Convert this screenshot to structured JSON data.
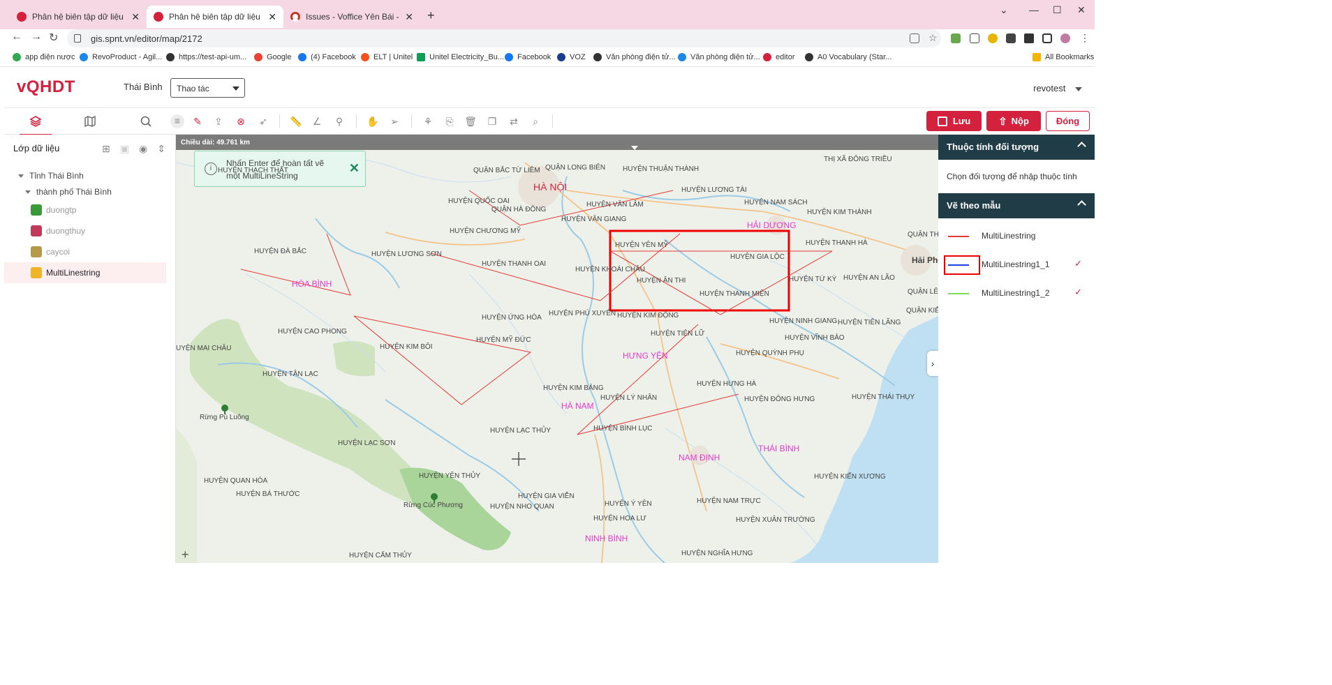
{
  "browser": {
    "tabs": [
      {
        "title": "Phân hệ biên tập dữ liệu bản đồ",
        "active": false
      },
      {
        "title": "Phân hệ biên tập dữ liệu bản đồ",
        "active": true
      },
      {
        "title": "Issues - Voffice Yên Bái - Redmine",
        "active": false
      }
    ],
    "url": "gis.spnt.vn/editor/map/2172",
    "bookmarks": [
      "app điện nược",
      "RevoProduct - Agil...",
      "https://test-api-um...",
      "Google",
      "(4) Facebook",
      "ELT | Unitel",
      "Unitel Electricity_Bu...",
      "Facebook",
      "VOZ",
      "Văn phòng điện tử...",
      "Văn phòng điện tử...",
      "editor",
      "A0 Vocabulary (Star...",
      "All Bookmarks"
    ]
  },
  "header": {
    "logo": "vQHDT",
    "province": "Thái Bình",
    "action_select": "Thao tác",
    "user": "revotest"
  },
  "left_panel": {
    "title": "Lớp dữ liệu",
    "tree": {
      "root": "Tỉnh Thái Bình",
      "child": "thành phố Thái Bình",
      "layers": [
        {
          "name": "duongtp",
          "color": "#3a9a3a"
        },
        {
          "name": "duongthuy",
          "color": "#c23a5a"
        },
        {
          "name": "caycoi",
          "color": "#b59a4a"
        },
        {
          "name": "MultiLinestring",
          "color": "#f0b429"
        }
      ]
    }
  },
  "actions": {
    "save": "Lưu",
    "submit": "Nộp",
    "close": "Đóng"
  },
  "map": {
    "measure": "Chiều dài: 49.761 km",
    "toast": "Nhấn Enter để hoàn tất vẽ một MultiLineString",
    "labels": {
      "hanoi": "HÀ NỘI",
      "hoabinh": "HÒA BÌNH",
      "haiduong": "HẢI DƯƠNG",
      "hungyen": "HƯNG YÊN",
      "hanam": "HÀ NAM",
      "namdinh": "NAM ĐỊNH",
      "thaibinh": "THÁI BÌNH",
      "ninhbinh": "NINH BÌNH",
      "haiphong": "Hải Phò",
      "thachthat": "HUYỆN THẠCH THẤT",
      "bactuliem": "QUẬN BẮC TỪ LIÊM",
      "longbien": "QUẬN LONG BIÊN",
      "thuanthanh": "HUYỆN THUẬN THÀNH",
      "dongtrieu": "THỊ XÃ ĐÔNG TRIỀU",
      "quocoai": "HUYỆN QUỐC OAI",
      "hadong": "QUẬN HÀ ĐÔNG",
      "vanlam": "HUYỆN VĂN LÂM",
      "luongtai": "HUYỆN LƯƠNG TÀI",
      "namsach": "HUYỆN NAM SÁCH",
      "kimthanh": "HUYỆN KIM THÀNH",
      "chuongmy": "HUYỆN CHƯƠNG MỸ",
      "vangiang": "HUYỆN VĂN GIANG",
      "yenmy": "HUYỆN YÊN MỸ",
      "thanhha": "HUYỆN THANH HÀ",
      "daбac": "HUYỆN ĐÀ BẮC",
      "luongson": "HUYỆN LƯƠNG SƠN",
      "thanhoai": "HUYỆN THANH OAI",
      "khoaichau": "HUYỆN KHOÁI CHÂU",
      "gialoc": "HUYỆN GIA LỘC",
      "anthi": "HUYỆN ÂN THI",
      "tuky": "HUYỆN TỨ KỲ",
      "anlao": "HUYỆN AN LÃO",
      "thanhmien": "HUYỆN THANH MIỆN",
      "unghoa": "HUYỆN ỨNG HÒA",
      "phuxuyen": "HUYỆN PHÚ XUYÊN",
      "kimdong": "HUYỆN KIM ĐỘNG",
      "ninhgiang": "HUYỆN NINH GIANG",
      "tienlang": "HUYỆN TIÊN LÃNG",
      "caophong": "HUYỆN CAO PHONG",
      "myduc": "HUYỆN MỸ ĐỨC",
      "tienlu": "HUYỆN TIÊN LỮ",
      "vinhbao": "HUYỆN VĨNH BẢO",
      "maichau": "UYỆN MAI CHÂU",
      "kimboi": "HUYỆN KIM BÔI",
      "quynhphu": "HUYỆN QUỲNH PHỤ",
      "tanlac": "HUYỆN TÂN LẠC",
      "kimbang": "HUYỆN KIM BẢNG",
      "hungha": "HUYỆN HƯNG HÀ",
      "lynhan": "HUYỆN LÝ NHÂN",
      "donghung": "HUYỆN ĐÔNG HƯNG",
      "thaithuy": "HUYỆN THÁI THỤY",
      "puluong": "Rừng Pù Luông",
      "binhluc": "HUYỆN BÌNH LỤC",
      "lacthuy": "HUYỆN LẠC THỦY",
      "lacson": "HUYỆN LẠC SƠN",
      "yenthuy": "HUYỆN YÊN THỦY",
      "kienxuong": "HUYỆN KIẾN XƯƠNG",
      "quanhoa": "HUYỆN QUAN HÓA",
      "bathuoc": "HUYỆN BÁ THƯỚC",
      "giavien": "HUYỆN GIA VIỄN",
      "namtruc": "HUYỆN NAM TRỰC",
      "cucphuong": "Rừng Cúc Phương",
      "nhoquan": "HUYỆN NHO QUAN",
      "yyen": "HUYỆN Ý YÊN",
      "xuantruong": "HUYỆN XUÂN TRƯỜNG",
      "hoalu": "HUYỆN HOA LƯ",
      "camthuy": "HUYỆN CẨM THỦY",
      "nghiahung": "HUYỆN NGHĨA HƯNG",
      "kienquan": "QUẬN KIẾN",
      "thuyquan": "QUẬN THỦY",
      "quanle": "QUẬN LÊ"
    }
  },
  "right_panel": {
    "attr_title": "Thuộc tính đối tượng",
    "attr_hint": "Chọn đối tượng để nhập thuộc tính",
    "tpl_title": "Vẽ theo mẫu",
    "templates": [
      {
        "name": "MultiLinestring",
        "color": "#e53935",
        "checked": false
      },
      {
        "name": "MultiLinestring1_1",
        "color": "#1e40e0",
        "checked": true
      },
      {
        "name": "MultiLinestring1_2",
        "color": "#7ed957",
        "checked": true
      }
    ],
    "check_glyph": "✓"
  }
}
